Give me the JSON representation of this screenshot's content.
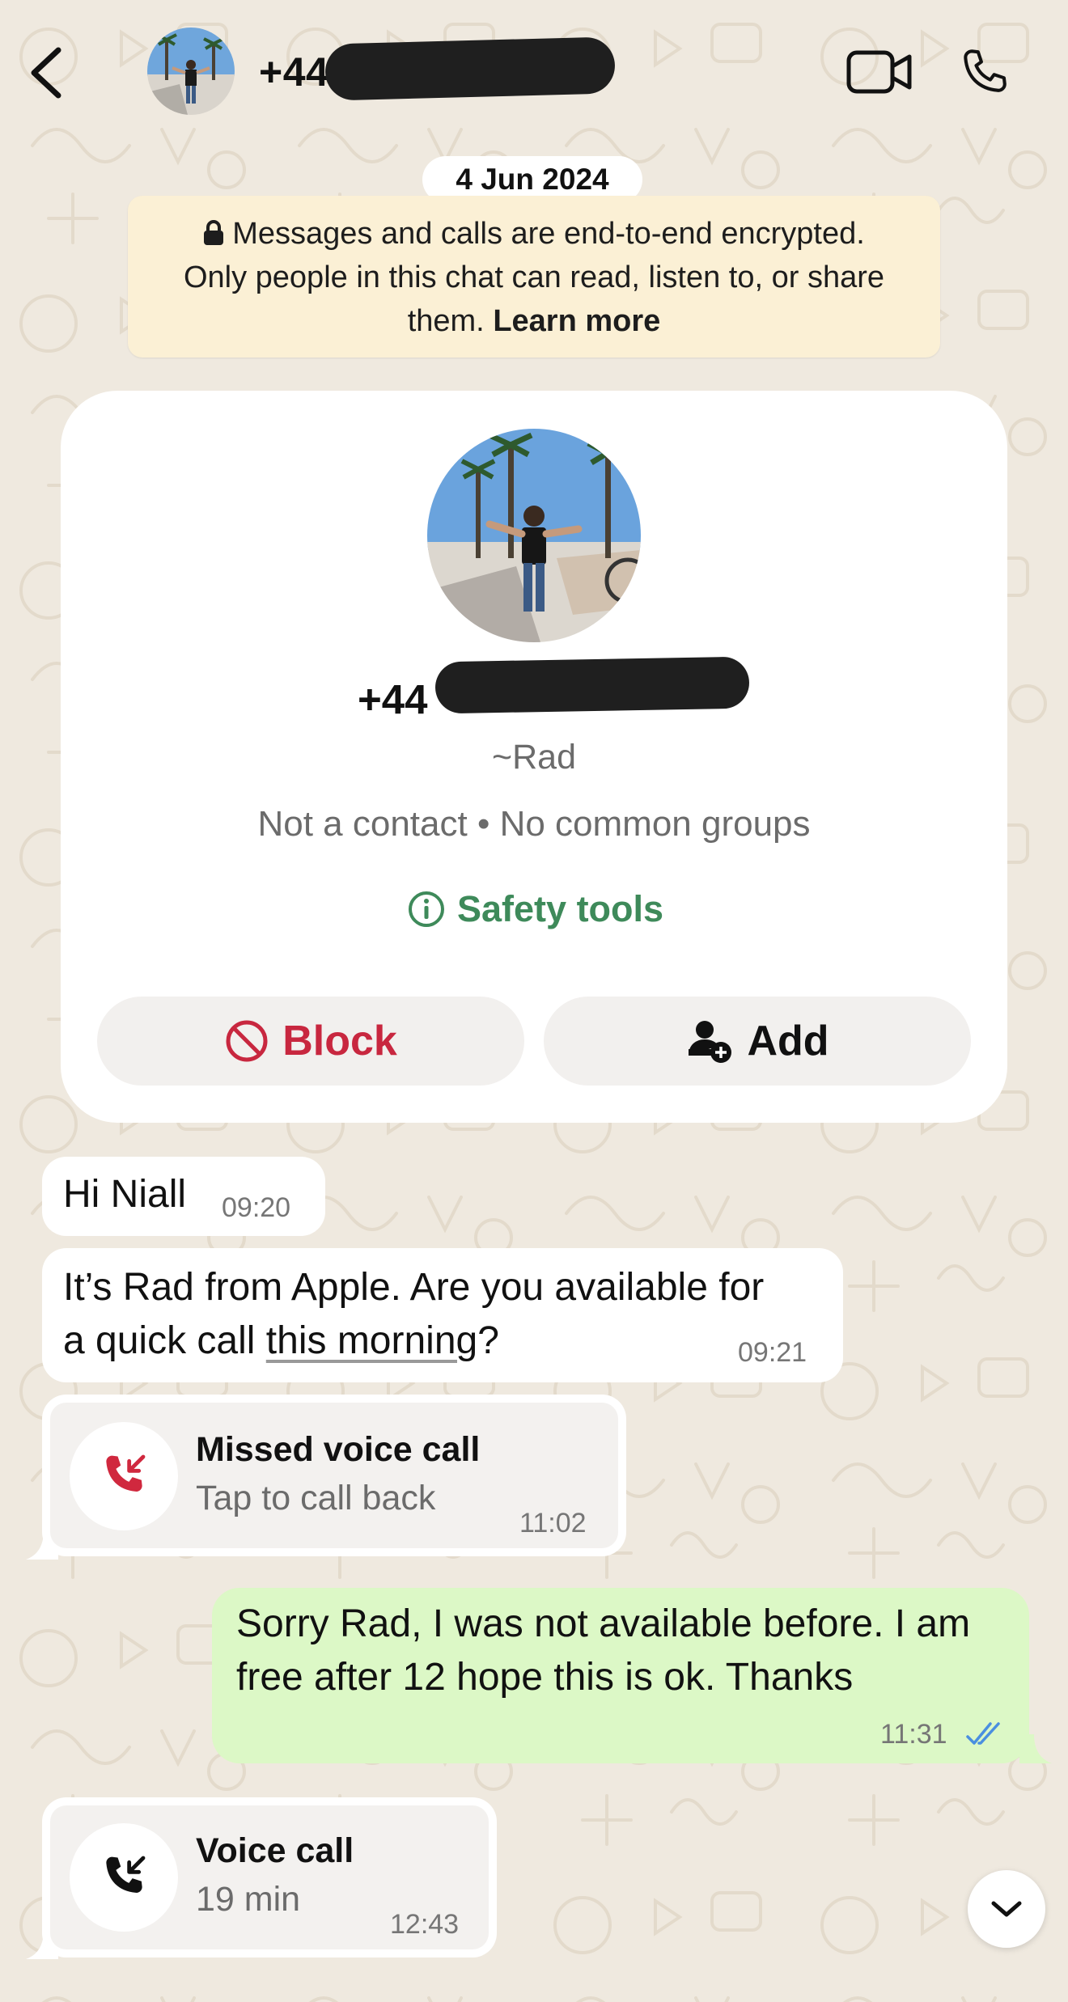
{
  "header": {
    "title": "+44",
    "back_icon": "chevron-left-icon",
    "video_icon": "video-camera-icon",
    "call_icon": "phone-icon"
  },
  "chat": {
    "date": "4 Jun 2024",
    "encryption_notice": {
      "line1": "Messages and calls are end-to-end encrypted.",
      "line2": "Only people in this chat can read, listen to, or share",
      "line3": "them.",
      "learn_more": "Learn more"
    }
  },
  "contact_card": {
    "number": "+44",
    "name": "~Rad",
    "meta": "Not a contact • No common groups",
    "safety_tools": "Safety tools",
    "block_label": "Block",
    "add_label": "Add"
  },
  "messages": [
    {
      "text": "Hi Niall",
      "time": "09:20"
    },
    {
      "text_line1": "It’s Rad from Apple. Are you available for",
      "text_line2_a": "a quick call ",
      "text_line2_link": "this morning",
      "text_line2_b": "?",
      "time": "09:21"
    },
    {
      "title": "Missed voice call",
      "subtitle": "Tap to call back",
      "time": "11:02"
    },
    {
      "text_line1": "Sorry Rad, I was not available before. I am",
      "text_line2": "free after 12 hope this is ok. Thanks",
      "time": "11:31"
    },
    {
      "title": "Voice call",
      "subtitle": "19 min",
      "time": "12:43"
    }
  ],
  "colors": {
    "background": "#efe9df",
    "outgoing_bubble": "#dcf8c6",
    "accent_green": "#3e8a5a",
    "block_red": "#c8273f",
    "read_tick_blue": "#4a8fe0"
  }
}
